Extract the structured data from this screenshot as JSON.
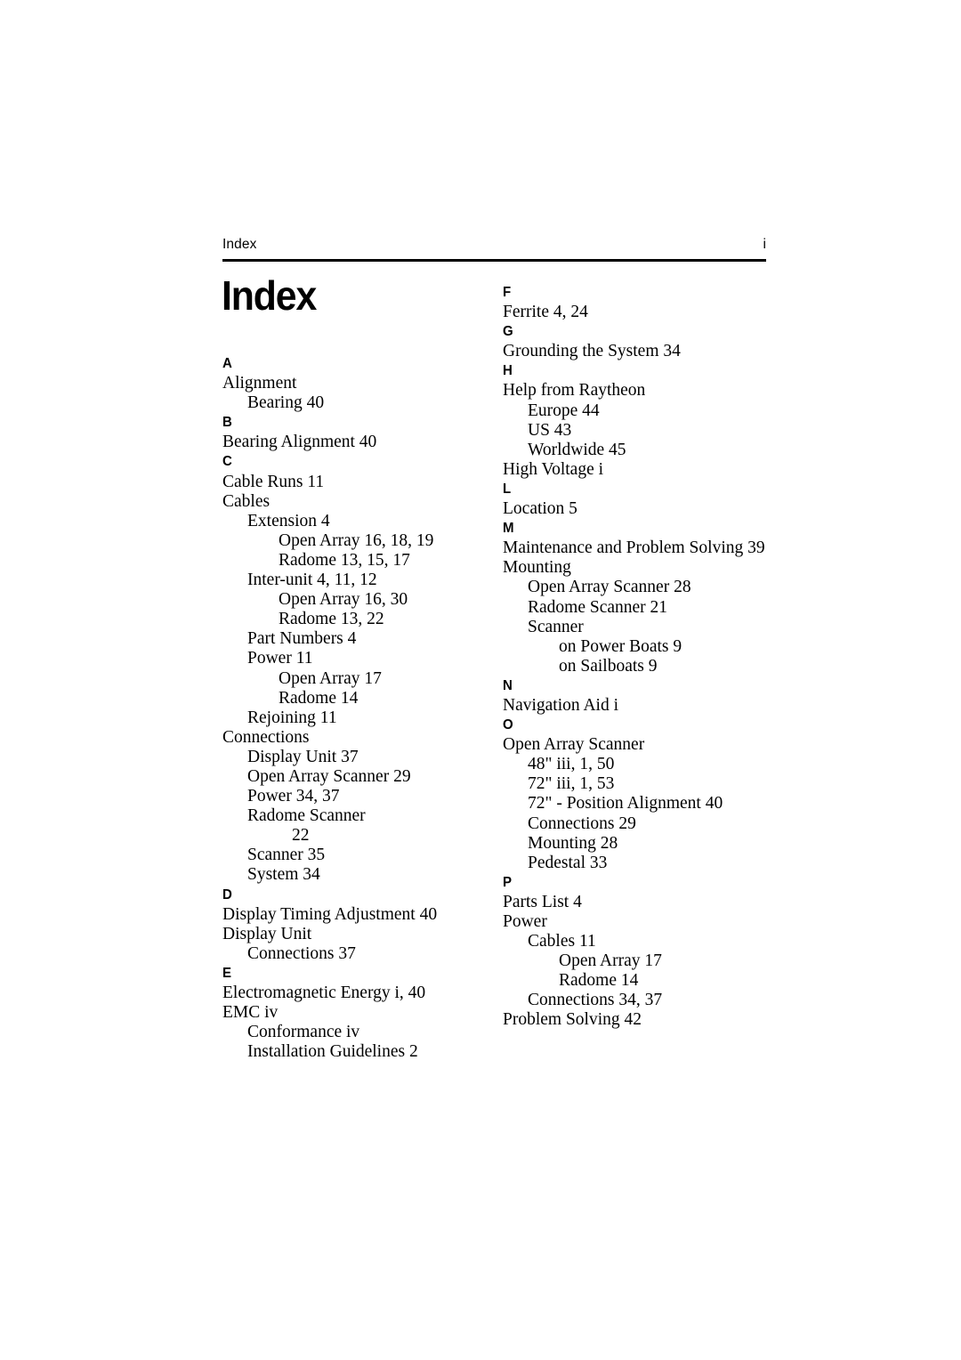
{
  "header": {
    "title": "Index",
    "folio": "i"
  },
  "page_title": "Index",
  "columns": [
    {
      "name": "left",
      "blocks": [
        {
          "letter": "A",
          "entries": [
            {
              "level": 1,
              "text": "Alignment"
            },
            {
              "level": 2,
              "text": "Bearing 40"
            }
          ]
        },
        {
          "letter": "B",
          "entries": [
            {
              "level": 1,
              "text": "Bearing Alignment 40"
            }
          ]
        },
        {
          "letter": "C",
          "entries": [
            {
              "level": 1,
              "text": "Cable Runs 11"
            },
            {
              "level": 1,
              "text": "Cables"
            },
            {
              "level": 2,
              "text": "Extension 4"
            },
            {
              "level": 3,
              "text": "Open Array 16, 18, 19"
            },
            {
              "level": 3,
              "text": "Radome 13, 15, 17"
            },
            {
              "level": 2,
              "text": "Inter-unit 4, 11, 12"
            },
            {
              "level": 3,
              "text": "Open Array 16, 30"
            },
            {
              "level": 3,
              "text": "Radome 13, 22"
            },
            {
              "level": 2,
              "text": "Part Numbers 4"
            },
            {
              "level": 2,
              "text": "Power 11"
            },
            {
              "level": 3,
              "text": "Open Array 17"
            },
            {
              "level": 3,
              "text": "Radome 14"
            },
            {
              "level": 2,
              "text": "Rejoining 11"
            },
            {
              "level": 1,
              "text": "Connections"
            },
            {
              "level": 2,
              "text": "Display Unit 37"
            },
            {
              "level": 2,
              "text": "Open Array Scanner 29"
            },
            {
              "level": 2,
              "text": "Power 34, 37"
            },
            {
              "level": 2,
              "text": "Radome Scanner"
            },
            {
              "level": 4,
              "text": "22"
            },
            {
              "level": 2,
              "text": "Scanner 35"
            },
            {
              "level": 2,
              "text": "System 34"
            }
          ]
        },
        {
          "letter": "D",
          "entries": [
            {
              "level": 1,
              "text": "Display Timing Adjustment 40"
            },
            {
              "level": 1,
              "text": "Display Unit"
            },
            {
              "level": 2,
              "text": "Connections 37"
            }
          ]
        },
        {
          "letter": "E",
          "entries": [
            {
              "level": 1,
              "text": "Electromagnetic Energy i, 40"
            },
            {
              "level": 1,
              "text": "EMC iv"
            },
            {
              "level": 2,
              "text": "Conformance iv"
            },
            {
              "level": 2,
              "text": "Installation Guidelines 2"
            }
          ]
        }
      ]
    },
    {
      "name": "right",
      "blocks": [
        {
          "letter": "F",
          "entries": [
            {
              "level": 1,
              "text": "Ferrite 4, 24"
            }
          ]
        },
        {
          "letter": "G",
          "entries": [
            {
              "level": 1,
              "text": "Grounding the System 34"
            }
          ]
        },
        {
          "letter": "H",
          "entries": [
            {
              "level": 1,
              "text": "Help from Raytheon"
            },
            {
              "level": 2,
              "text": "Europe 44"
            },
            {
              "level": 2,
              "text": "US 43"
            },
            {
              "level": 2,
              "text": "Worldwide 45"
            },
            {
              "level": 1,
              "text": "High Voltage i"
            }
          ]
        },
        {
          "letter": "L",
          "entries": [
            {
              "level": 1,
              "text": "Location 5"
            }
          ]
        },
        {
          "letter": "M",
          "entries": [
            {
              "level": 1,
              "text": "Maintenance and Problem Solving 39"
            },
            {
              "level": 1,
              "text": "Mounting"
            },
            {
              "level": 2,
              "text": "Open Array Scanner 28"
            },
            {
              "level": 2,
              "text": "Radome Scanner 21"
            },
            {
              "level": 2,
              "text": "Scanner"
            },
            {
              "level": 3,
              "text": "on Power Boats 9"
            },
            {
              "level": 3,
              "text": "on Sailboats 9"
            }
          ]
        },
        {
          "letter": "N",
          "entries": [
            {
              "level": 1,
              "text": "Navigation Aid i"
            }
          ]
        },
        {
          "letter": "O",
          "entries": [
            {
              "level": 1,
              "text": "Open Array Scanner"
            },
            {
              "level": 2,
              "text": "48\" iii, 1, 50"
            },
            {
              "level": 2,
              "text": "72\" iii, 1, 53"
            },
            {
              "level": 2,
              "text": "72\" - Position Alignment 40"
            },
            {
              "level": 2,
              "text": "Connections 29"
            },
            {
              "level": 2,
              "text": "Mounting 28"
            },
            {
              "level": 2,
              "text": "Pedestal 33"
            }
          ]
        },
        {
          "letter": "P",
          "entries": [
            {
              "level": 1,
              "text": "Parts List 4"
            },
            {
              "level": 1,
              "text": "Power"
            },
            {
              "level": 2,
              "text": "Cables 11"
            },
            {
              "level": 3,
              "text": "Open Array 17"
            },
            {
              "level": 3,
              "text": "Radome 14"
            },
            {
              "level": 2,
              "text": "Connections 34, 37"
            },
            {
              "level": 1,
              "text": "Problem Solving 42"
            }
          ]
        }
      ]
    }
  ]
}
